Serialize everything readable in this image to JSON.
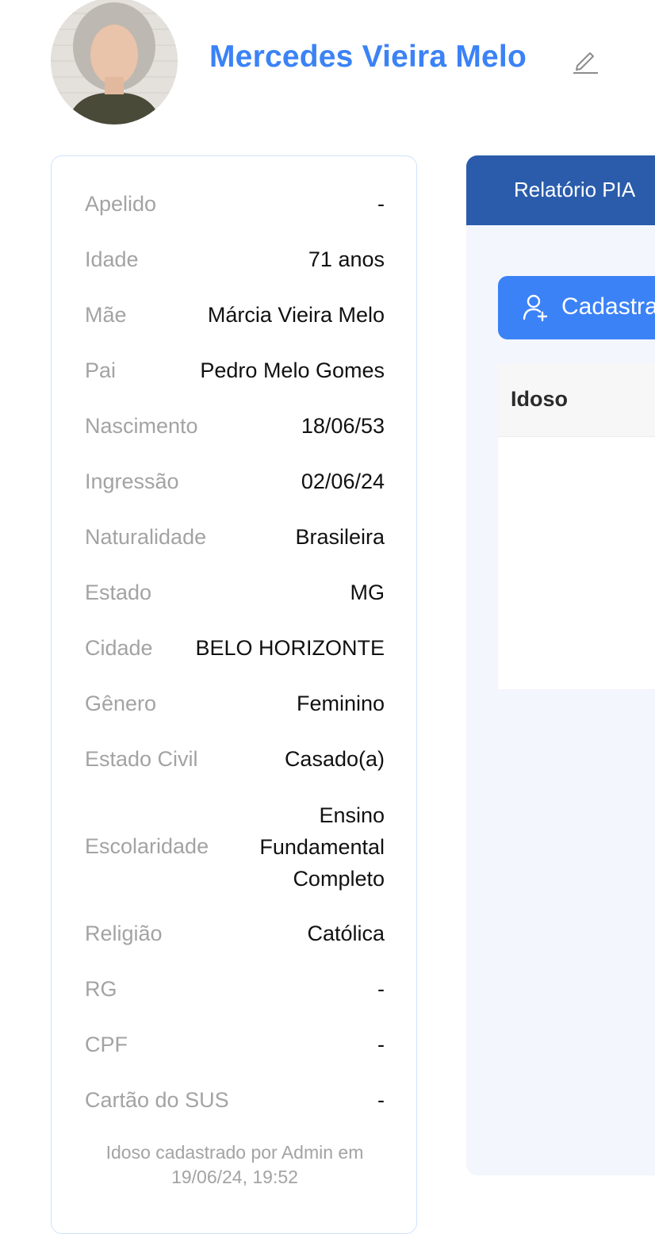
{
  "profile": {
    "name": "Mercedes Vieira Melo",
    "avatar_icon": "person-photo",
    "edit_icon": "pencil-icon"
  },
  "info": {
    "rows": [
      {
        "label": "Apelido",
        "value": "-"
      },
      {
        "label": "Idade",
        "value": "71 anos"
      },
      {
        "label": "Mãe",
        "value": "Márcia Vieira Melo"
      },
      {
        "label": "Pai",
        "value": "Pedro Melo Gomes"
      },
      {
        "label": "Nascimento",
        "value": "18/06/53"
      },
      {
        "label": "Ingressão",
        "value": "02/06/24"
      },
      {
        "label": "Naturalidade",
        "value": "Brasileira"
      },
      {
        "label": "Estado",
        "value": "MG"
      },
      {
        "label": "Cidade",
        "value": "BELO HORIZONTE"
      },
      {
        "label": "Gênero",
        "value": "Feminino"
      },
      {
        "label": "Estado Civil",
        "value": "Casado(a)"
      },
      {
        "label": "Escolaridade",
        "value": "Ensino Fundamental Completo"
      },
      {
        "label": "Religião",
        "value": "Católica"
      },
      {
        "label": "RG",
        "value": "-"
      },
      {
        "label": "CPF",
        "value": "-"
      },
      {
        "label": "Cartão do SUS",
        "value": "-"
      }
    ],
    "footer": "Idoso cadastrado por Admin em 19/06/24, 19:52"
  },
  "panel": {
    "tab_label": "Relatório PIA",
    "button_label": "Cadastrar",
    "button_icon": "add-user-icon",
    "table_header": "Idoso"
  },
  "colors": {
    "accent": "#3b82f6",
    "tab_bar": "#2a5cab",
    "panel_bg": "#f3f6fd",
    "card_border": "#cfe3fb",
    "muted_text": "#a3a3a3"
  }
}
